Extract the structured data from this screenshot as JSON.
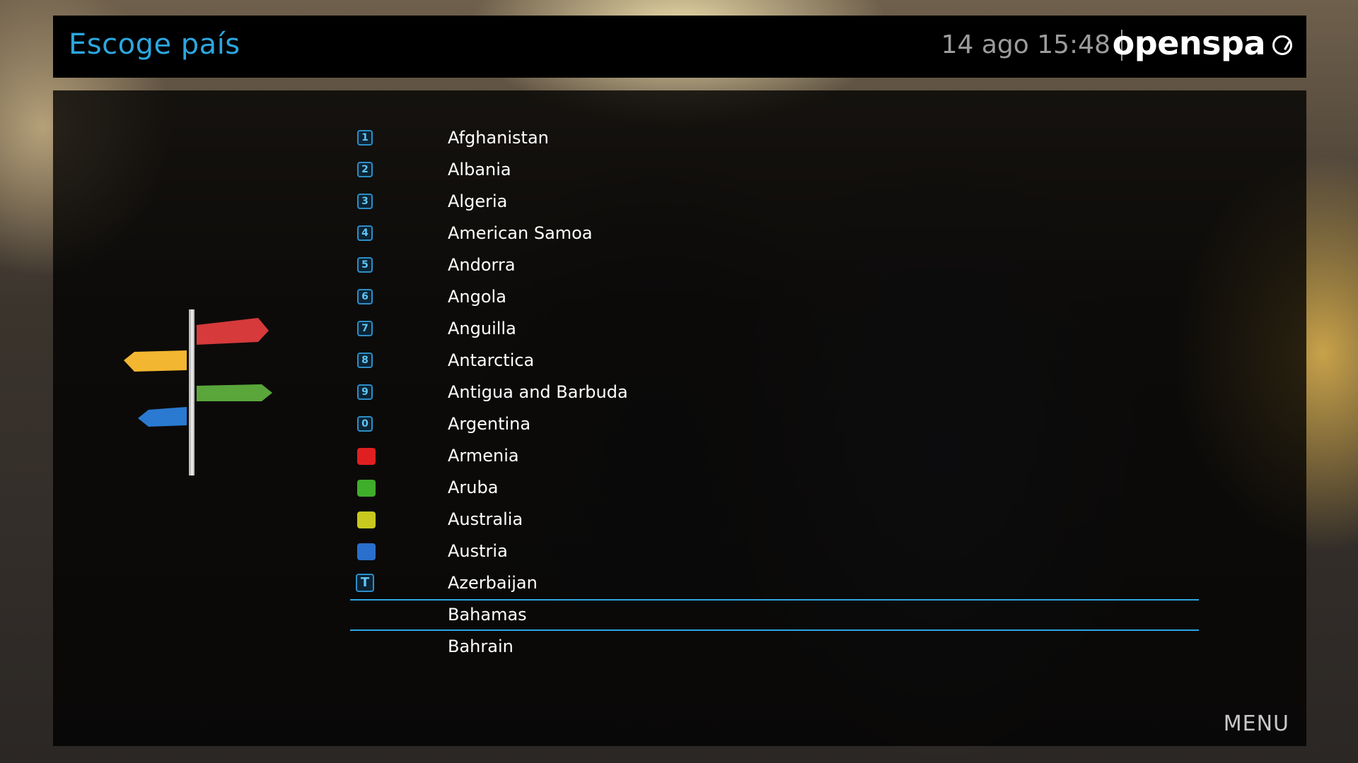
{
  "header": {
    "title": "Escoge país",
    "clock": "14 ago 15:48",
    "brand": "openspa"
  },
  "countries": [
    {
      "key": "1",
      "label": "Afghanistan"
    },
    {
      "key": "2",
      "label": "Albania"
    },
    {
      "key": "3",
      "label": "Algeria"
    },
    {
      "key": "4",
      "label": "American Samoa"
    },
    {
      "key": "5",
      "label": "Andorra"
    },
    {
      "key": "6",
      "label": "Angola"
    },
    {
      "key": "7",
      "label": "Anguilla"
    },
    {
      "key": "8",
      "label": "Antarctica"
    },
    {
      "key": "9",
      "label": "Antigua and Barbuda"
    },
    {
      "key": "0",
      "label": "Argentina"
    },
    {
      "color": "#e02020",
      "label": "Armenia"
    },
    {
      "color": "#3fae2a",
      "label": "Aruba"
    },
    {
      "color": "#c8c81e",
      "label": "Australia"
    },
    {
      "color": "#2a6fcc",
      "label": "Austria"
    },
    {
      "key": "T",
      "label": "Azerbaijan"
    },
    {
      "label": "Bahamas",
      "selected": true
    },
    {
      "label": "Bahrain"
    }
  ],
  "footer": {
    "menu_label": "MENU"
  },
  "colors": {
    "accent": "#2da6e0",
    "red": "#e02020",
    "green": "#3fae2a",
    "yellow": "#c8c81e",
    "blue": "#2a6fcc"
  },
  "icons": [
    "signpost-icon",
    "openspa-logo-icon"
  ]
}
